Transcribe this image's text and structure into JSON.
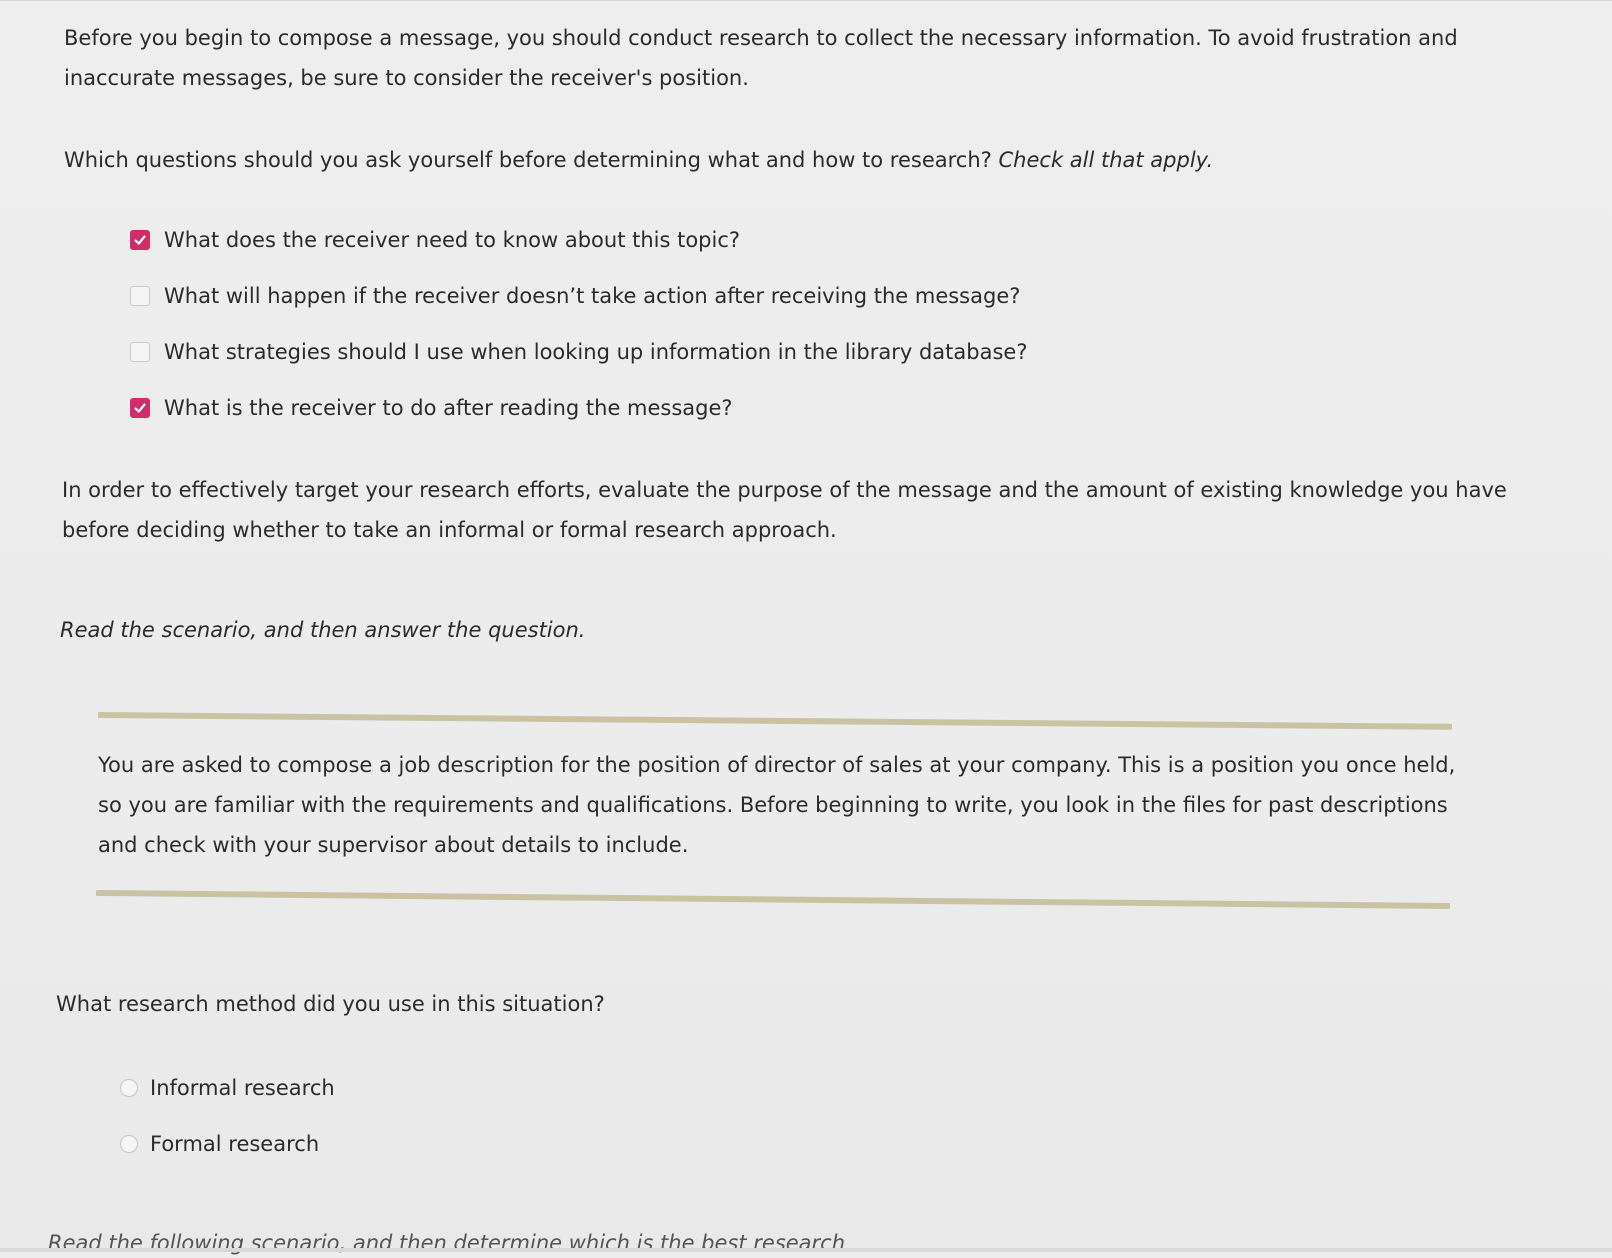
{
  "intro": "Before you begin to compose a message, you should conduct research to collect the necessary information. To avoid frustration and inaccurate messages, be sure to consider the receiver's position.",
  "question1": {
    "text": "Which questions should you ask yourself before determining what and how to research?",
    "instruction": "Check all that apply."
  },
  "options": [
    {
      "label": "What does the receiver need to know about this topic?",
      "checked": true
    },
    {
      "label": "What will happen if the receiver doesn’t take action after receiving the message?",
      "checked": false
    },
    {
      "label": "What strategies should I use when looking up information in the library database?",
      "checked": false
    },
    {
      "label": "What is the receiver to do after reading the message?",
      "checked": true
    }
  ],
  "intro2": "In order to effectively target your research efforts, evaluate the purpose of the message and the amount of existing knowledge you have before deciding whether to take an informal or formal research approach.",
  "scenario_intro": "Read the scenario, and then answer the question.",
  "scenario": "You are asked to compose a job description for the position of director of sales at your company. This is a position you once held, so you are familiar with the requirements and qualifications. Before beginning to write, you look in the files for past descriptions and check with your supervisor about details to include.",
  "question2": "What research method did you use in this situation?",
  "radio_options": [
    {
      "label": "Informal research",
      "selected": false
    },
    {
      "label": "Formal research",
      "selected": false
    }
  ],
  "next_scenario": "Read the following scenario, and then determine which is the best research",
  "colors": {
    "checkbox_checked": "#d12b6a",
    "rule": "#c9c3a4",
    "background": "#ededed",
    "text": "#2b2b2b"
  }
}
